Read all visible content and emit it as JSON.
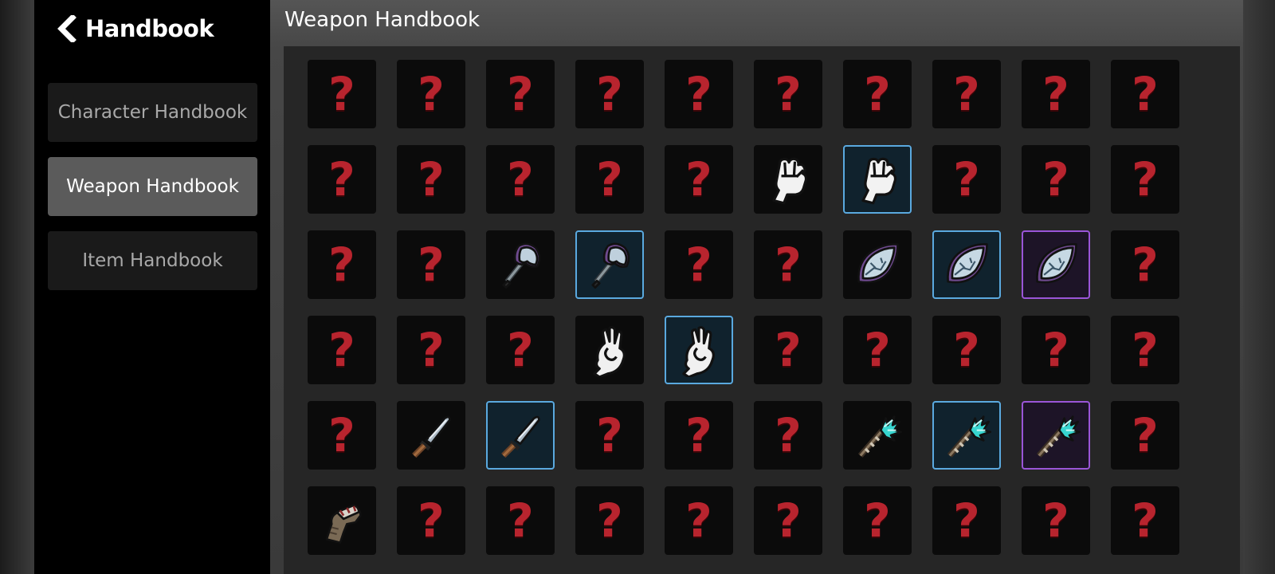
{
  "sidebar": {
    "back_title": "Handbook",
    "back_icon": "chevron-left-icon",
    "nav": [
      {
        "label": "Character Handbook",
        "active": false
      },
      {
        "label": "Weapon Handbook",
        "active": true
      },
      {
        "label": "Item Handbook",
        "active": false
      }
    ]
  },
  "panel_title": "Weapon Handbook",
  "colors": {
    "sidebar_bg": "#000000",
    "nav_inactive_bg": "#1a1a1a",
    "nav_active_bg": "#5b5b5b",
    "unknown_mark": "#b8242e",
    "rarity_blue": "#5aa9df",
    "rarity_purple": "#9a55d8"
  },
  "unknown_symbol": "?",
  "grid": {
    "columns": 10,
    "rows": [
      [
        "unknown",
        "unknown",
        "unknown",
        "unknown",
        "unknown",
        "unknown",
        "unknown",
        "unknown",
        "unknown",
        "unknown"
      ],
      [
        "unknown",
        "unknown",
        "unknown",
        "unknown",
        "unknown",
        "fist",
        "fist:blue",
        "unknown",
        "unknown",
        "unknown"
      ],
      [
        "unknown",
        "unknown",
        "axe",
        "axe:blue",
        "unknown",
        "unknown",
        "leaf-blade",
        "leaf-blade:blue",
        "leaf-blade:purple",
        "unknown"
      ],
      [
        "unknown",
        "unknown",
        "unknown",
        "claw-hand",
        "claw-hand:blue",
        "unknown",
        "unknown",
        "unknown",
        "unknown",
        "unknown"
      ],
      [
        "unknown",
        "knife",
        "knife:blue",
        "unknown",
        "unknown",
        "unknown",
        "lightning-staff",
        "lightning-staff:blue",
        "lightning-staff:purple",
        "unknown"
      ],
      [
        "gauntlet",
        "unknown",
        "unknown",
        "unknown",
        "unknown",
        "unknown",
        "unknown",
        "unknown",
        "unknown",
        "unknown"
      ]
    ]
  }
}
